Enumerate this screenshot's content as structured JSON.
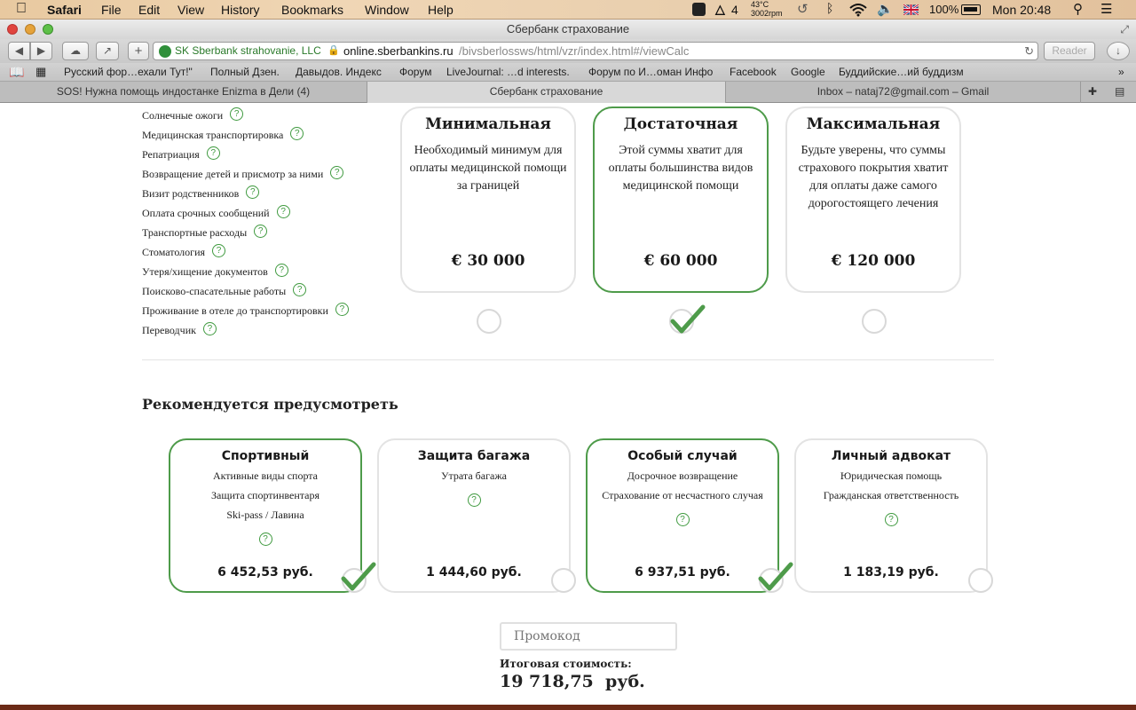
{
  "menubar": {
    "app": "Safari",
    "items": [
      "File",
      "Edit",
      "View",
      "History",
      "Bookmarks",
      "Window",
      "Help"
    ],
    "status": {
      "adobe_count": "4",
      "temp": "43°C",
      "rpm": "3002rpm",
      "battery": "100%",
      "clock": "Mon 20:48"
    }
  },
  "window": {
    "title": "Сбербанк страхование"
  },
  "toolbar": {
    "site_identity": "SK Sberbank strahovanie, LLC",
    "url_host": "online.sberbankins.ru",
    "url_path": "/bivsberlossws/html/vzr/index.html#/viewCalc",
    "reader": "Reader"
  },
  "bookmarks": [
    "Русский фор…ехали Тут!\"",
    "Полный Дзен.",
    "Давыдов. Индекс",
    "Форум",
    "LiveJournal: …d interests.",
    "Форум по И…оман Инфо",
    "Facebook",
    "Google",
    "Буддийские…ий буддизм"
  ],
  "tabs": [
    "SOS! Нужна помощь индостанке Enizma в Дели (4)",
    "Сбербанк страхование",
    "Inbox – nataj72@gmail.com – Gmail"
  ],
  "coverage_list": [
    "Солнечные ожоги",
    "Медицинская транспортировка",
    "Репатриация",
    "Возвращение детей и присмотр за ними",
    "Визит родственников",
    "Оплата срочных сообщений",
    "Транспортные расходы",
    "Стоматология",
    "Утеря/хищение документов",
    "Поисково-спасательные работы",
    "Проживание в отеле до транспортировки",
    "Переводчик"
  ],
  "help_glyph": "?",
  "plans": [
    {
      "title": "Минимальная",
      "desc": "Необходимый минимум для оплаты медицинской помощи за границей",
      "price": "€ 30 000",
      "selected": false
    },
    {
      "title": "Достаточная",
      "desc": "Этой суммы хватит для оплаты большинства видов медицинской помощи",
      "price": "€ 60 000",
      "selected": true
    },
    {
      "title": "Максимальная",
      "desc": "Будьте уверены, что суммы страхового покрытия хватит для оплаты даже самого дорогостоящего лечения",
      "price": "€ 120 000",
      "selected": false
    }
  ],
  "recommended": {
    "heading": "Рекомендуется предусмотреть",
    "options": [
      {
        "title": "Спортивный",
        "lines": [
          "Активные виды спорта",
          "Защита спортинвентаря",
          "Ski-pass / Лавина"
        ],
        "price": "6 452,53  руб.",
        "selected": true
      },
      {
        "title": "Защита багажа",
        "lines": [
          "Утрата багажа"
        ],
        "price": "1 444,60  руб.",
        "selected": false
      },
      {
        "title": "Особый случай",
        "lines": [
          "Досрочное возвращение",
          "Страхование от несчастного случая"
        ],
        "price": "6 937,51  руб.",
        "selected": true
      },
      {
        "title": "Личный адвокат",
        "lines": [
          "Юридическая помощь",
          "Гражданская ответственность"
        ],
        "price": "1 183,19  руб.",
        "selected": false
      }
    ]
  },
  "promo": {
    "placeholder": "Промокод"
  },
  "total": {
    "label": "Итоговая стоимость:",
    "value": "19 718,75  руб."
  },
  "colors": {
    "accent": "#4e9b4a",
    "card_border": "#e3e3e3"
  }
}
